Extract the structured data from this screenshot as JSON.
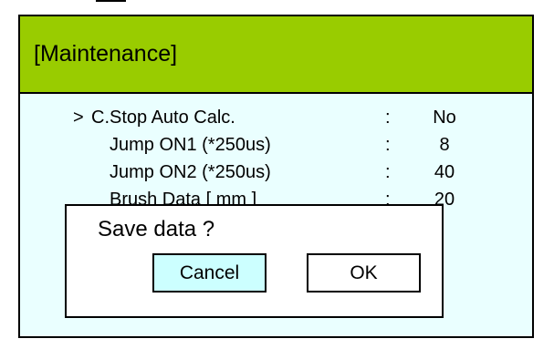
{
  "screen": {
    "title": "[Maintenance]"
  },
  "params": [
    {
      "cursor": ">",
      "label": "C.Stop Auto Calc.",
      "colon": ":",
      "value": "No"
    },
    {
      "cursor": "",
      "label": "Jump ON1 (*250us)",
      "colon": ":",
      "value": "8"
    },
    {
      "cursor": "",
      "label": "Jump ON2 (*250us)",
      "colon": ":",
      "value": "40"
    },
    {
      "cursor": "",
      "label": "Brush Data [ mm ]",
      "colon": ":",
      "value": "20"
    }
  ],
  "dialog": {
    "message": "Save data ?",
    "cancel_label": "Cancel",
    "ok_label": "OK"
  },
  "colors": {
    "title_bar": "#99cc00",
    "screen_bg": "#eaffff",
    "selected_button": "#ccffff"
  }
}
